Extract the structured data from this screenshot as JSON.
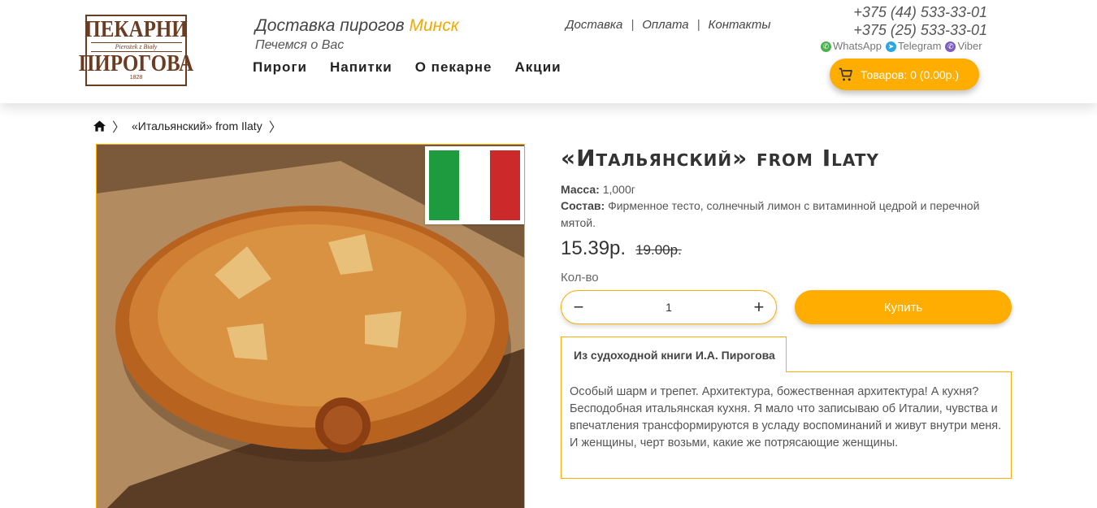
{
  "logo": {
    "line1": "ПЕКАРНИ",
    "line2": "Pierożek z Biały",
    "line3": "ПИРОГОВА",
    "line4": "1828"
  },
  "header": {
    "tagline": "Доставка пирогов",
    "city": "Минск",
    "subtagline": "Печемся о Вас",
    "main_nav": [
      "Пироги",
      "Напитки",
      "О пекарне",
      "Акции"
    ],
    "top_nav": [
      "Доставка",
      "Оплата",
      "Контакты"
    ],
    "phones": [
      "+375 (44) 533-33-01",
      "+375 (25) 533-33-01"
    ],
    "messengers": [
      "WhatsApp",
      "Telegram",
      "Viber"
    ],
    "cart_label": "Товаров: 0 (0.00р.)"
  },
  "breadcrumb": {
    "current": "«Итальянский» from Ilaty"
  },
  "product": {
    "title": "«Итальянский» from Ilaty",
    "mass_label": "Масса:",
    "mass_value": " 1,000г",
    "composition_label": "Состав:",
    "composition_value": " Фирменное тесто, солнечный лимон с витаминной цедрой и перечной мятой.",
    "price_now": "15.39р.",
    "price_old": "19.00р.",
    "qty_label": "Кол-во",
    "qty_value": "1",
    "buy_label": "Купить",
    "tab_label": "Из судоходной книги И.А. Пирогова",
    "description": "Особый шарм и трепет. Архитектура, божественная архитектура! А кухня? Бесподобная итальянская кухня. Я мало что записываю об Италии, чувства и впечатления трансформируются в усладу воспоминаний и живут внутри меня.",
    "description2": "И женщины, черт возьми, какие же потрясающие женщины."
  },
  "colors": {
    "accent": "#ffad00",
    "flag_green": "#1e9b3f",
    "flag_red": "#cc2a2a"
  }
}
